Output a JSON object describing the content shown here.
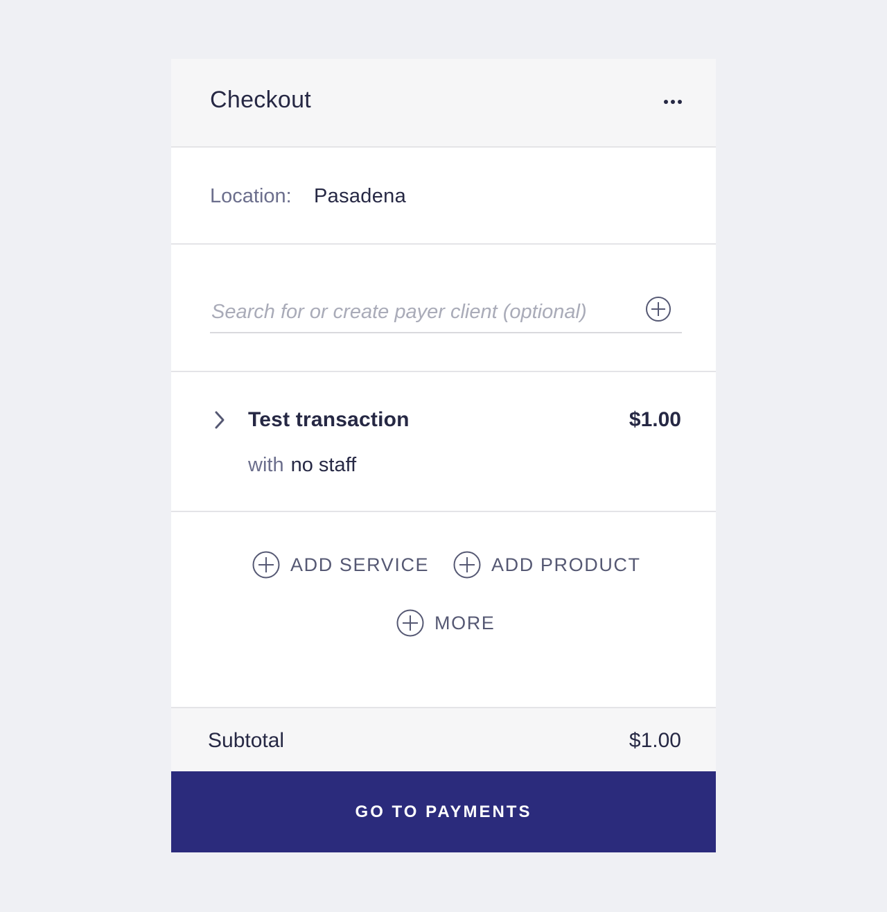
{
  "header": {
    "title": "Checkout",
    "more_icon": "more-horizontal-icon"
  },
  "location": {
    "label": "Location:",
    "value": "Pasadena"
  },
  "search": {
    "value": "",
    "placeholder": "Search for or create payer client (optional)",
    "add_icon": "plus-circle-icon"
  },
  "line_item": {
    "expand_icon": "chevron-right-icon",
    "name": "Test transaction",
    "price": "$1.00",
    "staff_prefix": "with",
    "staff_value": "no staff"
  },
  "actions": {
    "add_service": "ADD SERVICE",
    "add_product": "ADD PRODUCT",
    "more": "MORE",
    "icon": "plus-circle-icon"
  },
  "summary": {
    "subtotal_label": "Subtotal",
    "subtotal_value": "$1.00"
  },
  "footer": {
    "pay_button_label": "GO TO PAYMENTS"
  },
  "colors": {
    "background": "#eff0f4",
    "panel": "#ffffff",
    "header_bg": "#f6f6f7",
    "text_primary": "#262844",
    "text_secondary": "#6b6e8c",
    "accent": "#2b2b7c"
  }
}
